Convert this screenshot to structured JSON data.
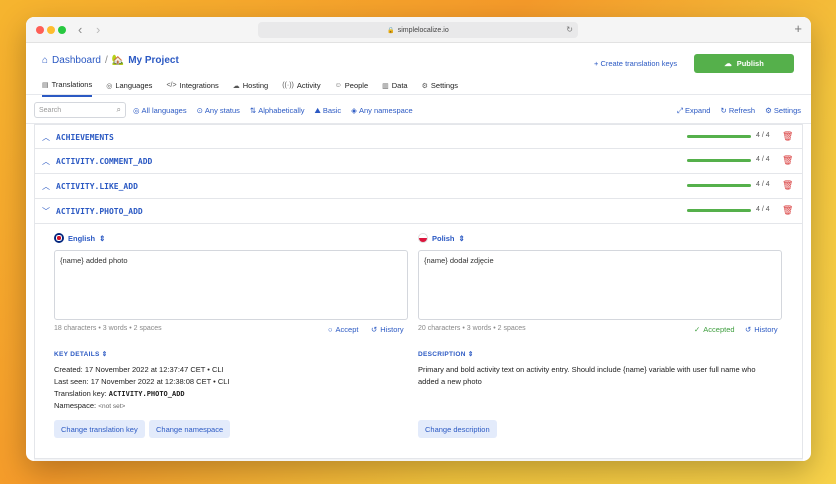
{
  "browser": {
    "url": "simplelocalize.io"
  },
  "header": {
    "breadcrumb_root": "Dashboard",
    "breadcrumb_sep": "/",
    "project_name": "My Project",
    "create_keys": "Create translation keys",
    "publish": "Publish"
  },
  "tabs": [
    {
      "label": "Translations",
      "icon": "translations-icon"
    },
    {
      "label": "Languages",
      "icon": "globe-icon"
    },
    {
      "label": "Integrations",
      "icon": "code-icon"
    },
    {
      "label": "Hosting",
      "icon": "cloud-icon"
    },
    {
      "label": "Activity",
      "icon": "activity-icon"
    },
    {
      "label": "People",
      "icon": "people-icon"
    },
    {
      "label": "Data",
      "icon": "database-icon"
    },
    {
      "label": "Settings",
      "icon": "gear-icon"
    }
  ],
  "toolbar": {
    "search_placeholder": "Search",
    "all_languages": "All languages",
    "any_status": "Any status",
    "alphabetically": "Alphabetically",
    "basic": "Basic",
    "any_namespace": "Any namespace",
    "expand": "Expand",
    "refresh": "Refresh",
    "settings": "Settings"
  },
  "keys": [
    {
      "name": "ACHIEVEMENTS",
      "progress": "4 / 4",
      "fraction": 1.0
    },
    {
      "name": "ACTIVITY.COMMENT_ADD",
      "progress": "4 / 4",
      "fraction": 1.0
    },
    {
      "name": "ACTIVITY.LIKE_ADD",
      "progress": "4 / 4",
      "fraction": 1.0
    },
    {
      "name": "ACTIVITY.PHOTO_ADD",
      "progress": "4 / 4",
      "fraction": 1.0
    }
  ],
  "expanded": {
    "english": {
      "label": "English",
      "text": "{name} added photo",
      "meta": "18 characters • 3 words • 2 spaces",
      "accept": "Accept",
      "history": "History"
    },
    "polish": {
      "label": "Polish",
      "text": "{name} dodał zdjęcie",
      "meta": "20 characters • 3 words • 2 spaces",
      "accepted": "Accepted",
      "history": "History"
    },
    "key_details_title": "KEY DETAILS",
    "created": "Created: 17 November 2022 at 12:37:47 CET • CLI",
    "last_seen": "Last seen: 17 November 2022 at 12:38:08 CET • CLI",
    "translation_key_label": "Translation key:",
    "translation_key": "ACTIVITY.PHOTO_ADD",
    "namespace_label": "Namespace:",
    "namespace": "<not set>",
    "description_title": "DESCRIPTION",
    "description": "Primary and bold activity text on activity entry. Should include {name} variable with user full name who added a new photo",
    "change_key": "Change translation key",
    "change_namespace": "Change namespace",
    "change_description": "Change description"
  },
  "colors": {
    "accent": "#2b59c3",
    "success": "#55b04b",
    "danger": "#d83a3a"
  }
}
